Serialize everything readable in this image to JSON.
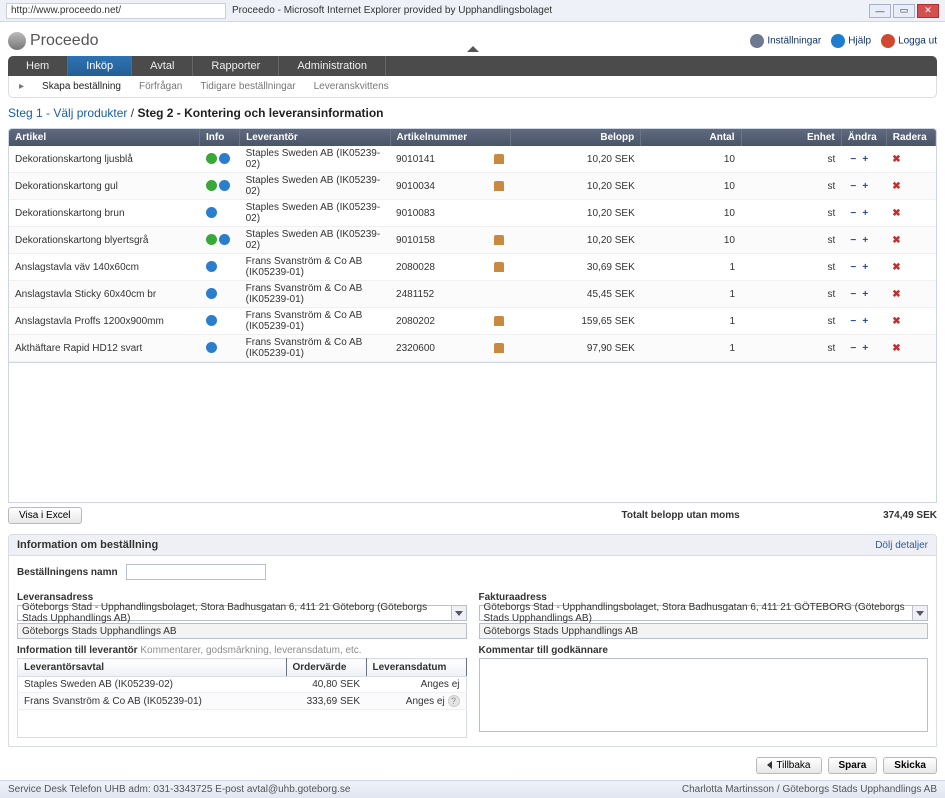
{
  "window": {
    "url": "http://www.proceedo.net/",
    "title": "Proceedo - Microsoft Internet Explorer provided by Upphandlingsbolaget"
  },
  "brand": "Proceedo",
  "header_actions": {
    "settings": "Inställningar",
    "help": "Hjälp",
    "logout": "Logga ut"
  },
  "nav": {
    "tabs": [
      "Hem",
      "Inköp",
      "Avtal",
      "Rapporter",
      "Administration"
    ],
    "active": 1,
    "sub": [
      "Skapa beställning",
      "Förfrågan",
      "Tidigare beställningar",
      "Leveranskvittens"
    ]
  },
  "breadcrumb": {
    "step1_label": "Steg 1",
    "step1_text": "Välj produkter",
    "step2_label": "Steg 2",
    "step2_text": "Kontering och leveransinformation"
  },
  "columns": {
    "artikel": "Artikel",
    "info": "Info",
    "leverantor": "Leverantör",
    "artikelnummer": "Artikelnummer",
    "belopp": "Belopp",
    "antal": "Antal",
    "enhet": "Enhet",
    "andra": "Ändra",
    "radera": "Radera"
  },
  "rows": [
    {
      "artikel": "Dekorationskartong ljusblå",
      "green": true,
      "blue": true,
      "lev": "Staples Sweden AB (IK05239-02)",
      "artnr": "9010141",
      "bag": true,
      "belopp": "10,20 SEK",
      "antal": "10",
      "enhet": "st"
    },
    {
      "artikel": "Dekorationskartong gul",
      "green": true,
      "blue": true,
      "lev": "Staples Sweden AB (IK05239-02)",
      "artnr": "9010034",
      "bag": true,
      "belopp": "10,20 SEK",
      "antal": "10",
      "enhet": "st"
    },
    {
      "artikel": "Dekorationskartong brun",
      "green": false,
      "blue": true,
      "lev": "Staples Sweden AB (IK05239-02)",
      "artnr": "9010083",
      "bag": false,
      "belopp": "10,20 SEK",
      "antal": "10",
      "enhet": "st"
    },
    {
      "artikel": "Dekorationskartong blyertsgrå",
      "green": true,
      "blue": true,
      "lev": "Staples Sweden AB (IK05239-02)",
      "artnr": "9010158",
      "bag": true,
      "belopp": "10,20 SEK",
      "antal": "10",
      "enhet": "st"
    },
    {
      "artikel": "Anslagstavla väv    140x60cm",
      "green": false,
      "blue": true,
      "lev": "Frans Svanström & Co AB (IK05239-01)",
      "artnr": "2080028",
      "bag": true,
      "belopp": "30,69 SEK",
      "antal": "1",
      "enhet": "st"
    },
    {
      "artikel": "Anslagstavla Sticky 60x40cm br",
      "green": false,
      "blue": true,
      "lev": "Frans Svanström & Co AB (IK05239-01)",
      "artnr": "2481152",
      "bag": false,
      "belopp": "45,45 SEK",
      "antal": "1",
      "enhet": "st"
    },
    {
      "artikel": "Anslagstavla Proffs 1200x900mm",
      "green": false,
      "blue": true,
      "lev": "Frans Svanström & Co AB (IK05239-01)",
      "artnr": "2080202",
      "bag": true,
      "belopp": "159,65 SEK",
      "antal": "1",
      "enhet": "st"
    },
    {
      "artikel": "Akthäftare Rapid HD12    svart",
      "green": false,
      "blue": true,
      "lev": "Frans Svanström & Co AB (IK05239-01)",
      "artnr": "2320600",
      "bag": true,
      "belopp": "97,90 SEK",
      "antal": "1",
      "enhet": "st"
    }
  ],
  "buttons": {
    "excel": "Visa i Excel",
    "back": "Tillbaka",
    "save": "Spara",
    "send": "Skicka"
  },
  "totals": {
    "label": "Totalt belopp utan moms",
    "value": "374,49 SEK"
  },
  "info_section": {
    "title": "Information om beställning",
    "hide": "Dölj detaljer",
    "order_name_label": "Beställningens namn",
    "leveransadress_label": "Leveransadress",
    "fakturaadress_label": "Fakturaadress",
    "address_line1": "Göteborgs Stad - Upphandlingsbolaget, Stora Badhusgatan 6, 411 21 Göteborg (Göteborgs Stads Upphandlings AB)",
    "address_dept": "Göteborgs Stads Upphandlings AB",
    "invoice_line1": "Göteborgs Stad - Upphandlingsbolaget, Stora Badhusgatan 6, 411 21 GÖTEBORG (Göteborgs Stads Upphandlings AB)",
    "supplier_info_label": "Information till leverantör",
    "supplier_info_hint": "Kommentarer, godsmärkning, leveransdatum, etc.",
    "approver_comment_label": "Kommentar till godkännare",
    "supp_table": {
      "col_lev": "Leverantörsavtal",
      "col_ord": "Ordervärde",
      "col_dat": "Leveransdatum",
      "r": [
        {
          "lev": "Staples Sweden AB (IK05239-02)",
          "ord": "40,80 SEK",
          "dat": "Anges ej",
          "q": false
        },
        {
          "lev": "Frans Svanström & Co AB (IK05239-01)",
          "ord": "333,69 SEK",
          "dat": "Anges ej",
          "q": true
        }
      ]
    }
  },
  "status_bar": {
    "left": "Service Desk Telefon UHB adm: 031-3343725   E-post avtal@uhb.goteborg.se",
    "right": "Charlotta Martinsson / Göteborgs Stads Upphandlings AB"
  }
}
